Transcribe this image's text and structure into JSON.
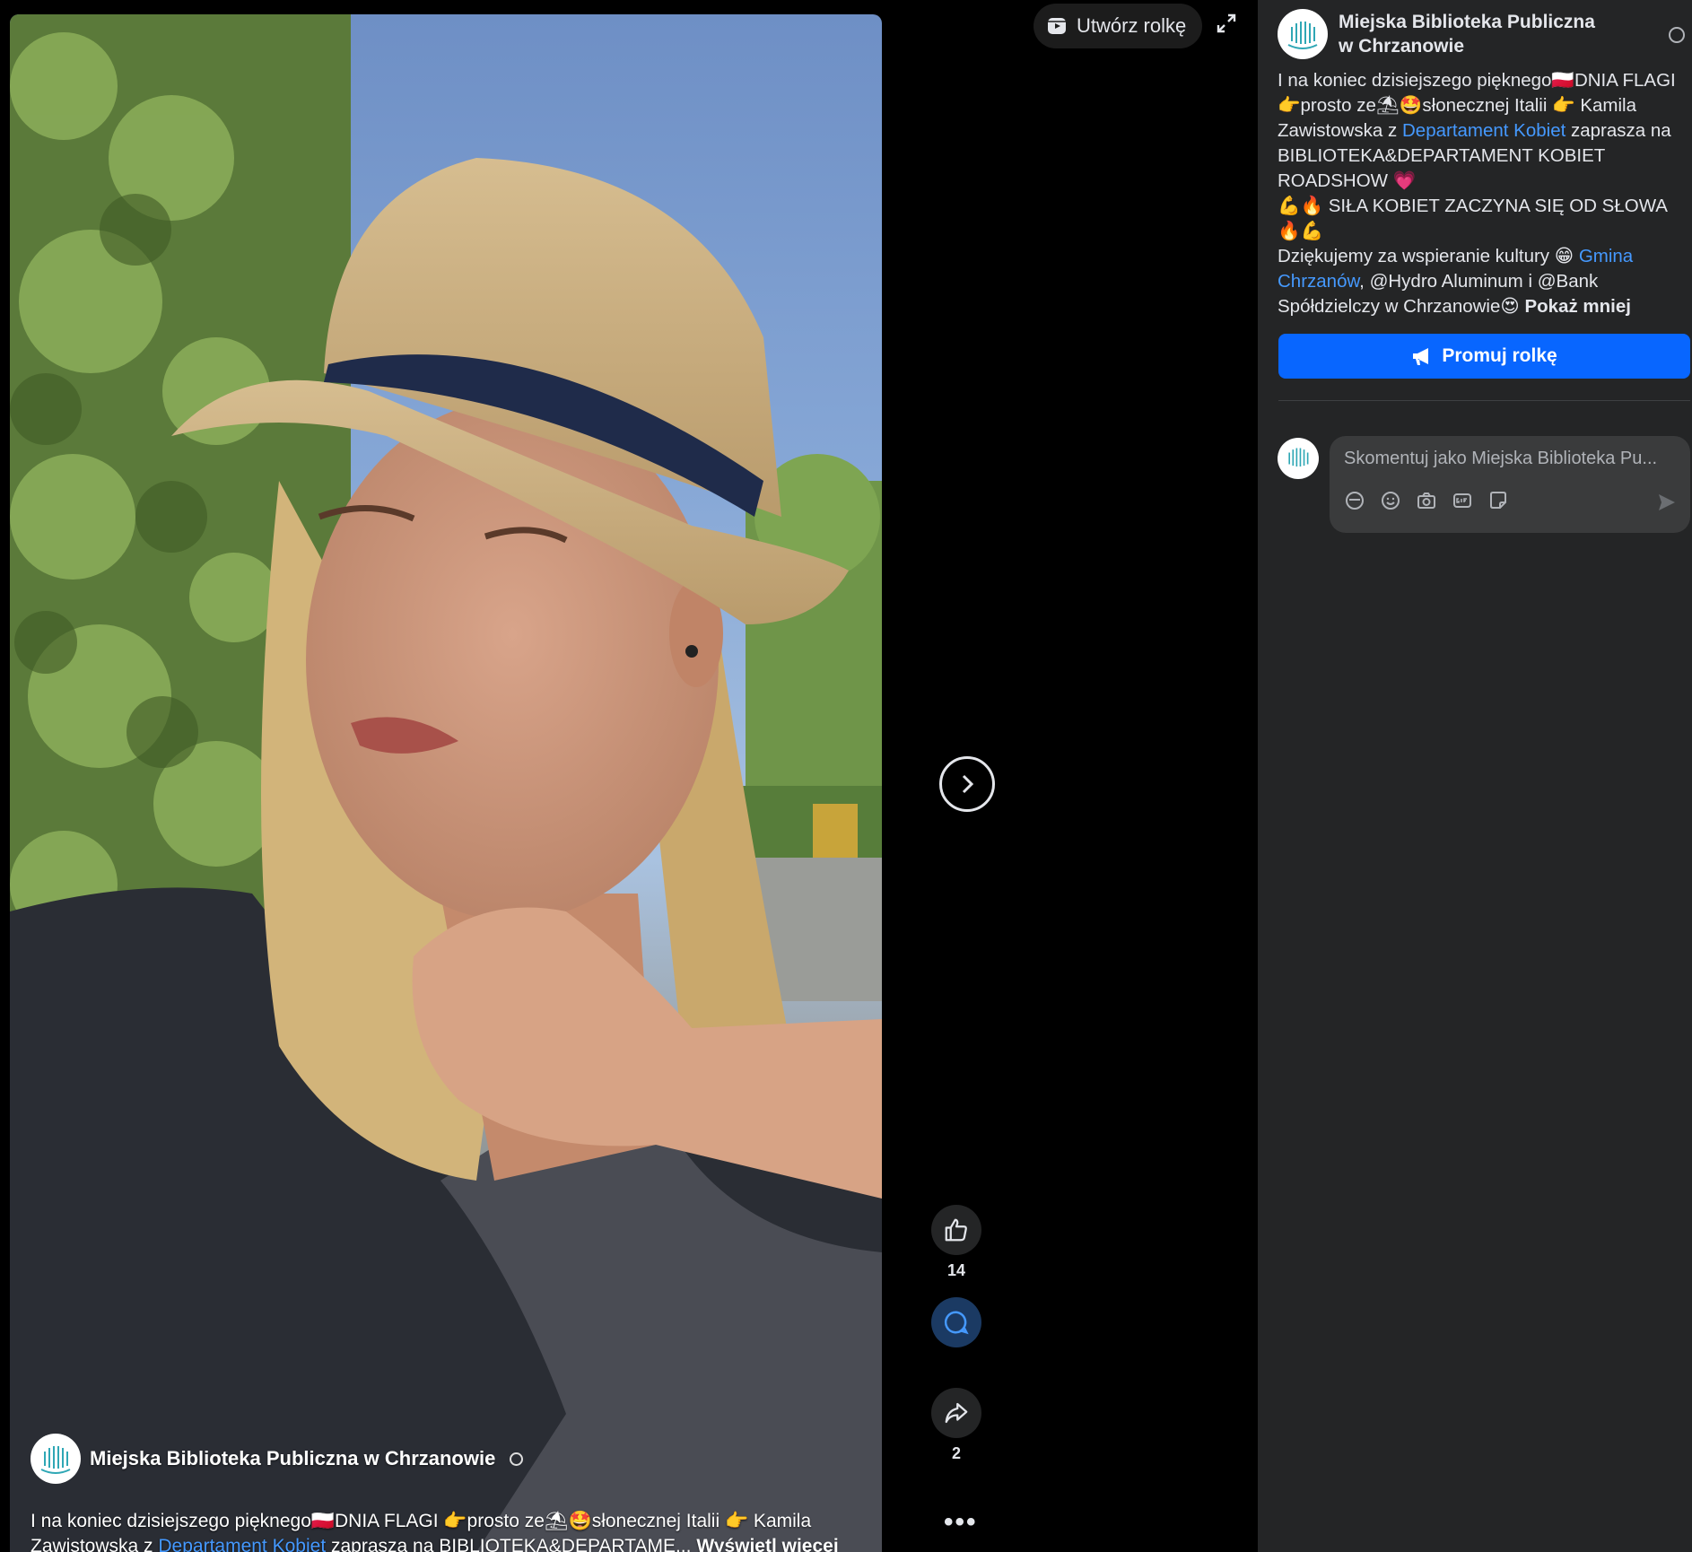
{
  "page": {
    "author": "Miejska Biblioteka Publiczna w Chrzanowie"
  },
  "video": {
    "author": "Miejska Biblioteka Publiczna w Chrzanowie",
    "caption": {
      "line1_a": "I na koniec dzisiejszego pięknego🇵🇱DNIA FLAGI 👉prosto ze⛱🤩słonecznej Italii 👉 Kamila",
      "line2_a": "Zawistowska z ",
      "line2_link": "Departament Kobiet",
      "line2_b": " zaprasza na BIBLIOTEKA&DEPARTAME...",
      "more": "Wyświetl więcej"
    }
  },
  "toolbar": {
    "create_reel": "Utwórz rolkę"
  },
  "actions": {
    "likes": "14",
    "shares": "2"
  },
  "post": {
    "header_name": "Miejska Biblioteka Publiczna w Chrzanowie",
    "text": {
      "l1": "I na koniec dzisiejszego pięknego🇵🇱DNIA FLAGI 👉prosto ze⛱🤩słonecznej Italii 👉 Kamila Zawistowska z ",
      "link1": "Departament Kobiet",
      "l1b": " zaprasza na BIBLIOTEKA&DEPARTAMENT KOBIET ROADSHOW 💗",
      "l2": "💪🔥 SIŁA KOBIET ZACZYNA SIĘ OD SŁOWA 🔥💪",
      "l3a": "Dziękujemy za wspieranie kultury 😁 ",
      "link2": "Gmina Chrzanów",
      "l3b": ", @Hydro Aluminum i @Bank Spółdzielczy w Chrzanowie😍 ",
      "less": "Pokaż mniej"
    },
    "promote_button": "Promuj rolkę",
    "comment_placeholder": "Skomentuj jako Miejska Biblioteka Pu..."
  },
  "colors": {
    "accent": "#0866ff",
    "link": "#4599ff",
    "panel_bg": "#242526"
  }
}
